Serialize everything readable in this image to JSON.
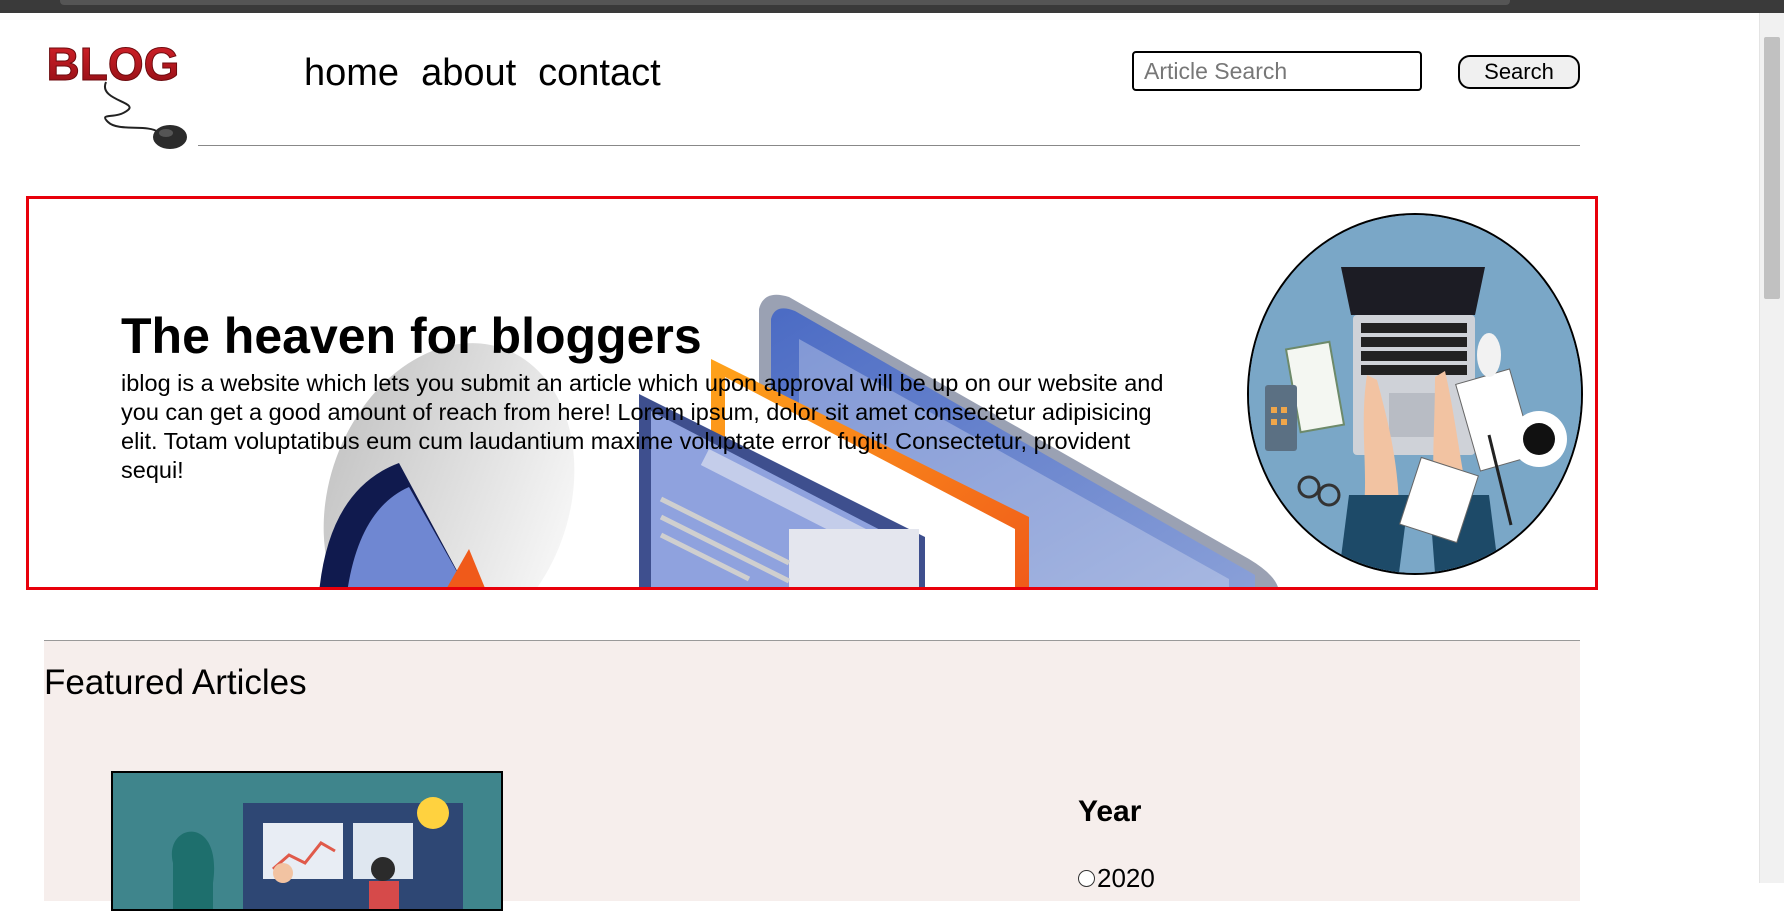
{
  "header": {
    "logo_text": "BLOG",
    "nav": [
      "home",
      "about",
      "contact"
    ],
    "search_placeholder": "Article Search",
    "search_button": "Search"
  },
  "hero": {
    "title": "The heaven for bloggers",
    "text": "iblog is a website which lets you submit an article which upon approval will be up on our website and you can get a good amount of reach from here! Lorem ipsum, dolor sit amet consectetur adipisicing elit. Totam voluptatibus eum cum laudantium maxime voluptate error fugit! Consectetur, provident sequi!"
  },
  "featured": {
    "title": "Featured Articles",
    "year_heading": "Year",
    "year_options": [
      "2020"
    ]
  },
  "colors": {
    "hero_border": "#e8000b",
    "featured_bg": "#f6eeec",
    "logo_red": "#b3121a"
  }
}
